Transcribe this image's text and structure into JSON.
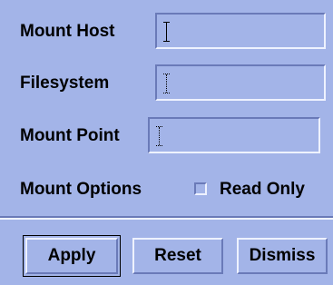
{
  "form": {
    "mount_host": {
      "label": "Mount Host",
      "value": ""
    },
    "filesystem": {
      "label": "Filesystem",
      "value": ""
    },
    "mount_point": {
      "label": "Mount Point",
      "value": ""
    },
    "mount_options": {
      "label": "Mount Options",
      "read_only_label": "Read Only",
      "read_only_checked": false
    }
  },
  "buttons": {
    "apply": "Apply",
    "reset": "Reset",
    "dismiss": "Dismiss"
  }
}
